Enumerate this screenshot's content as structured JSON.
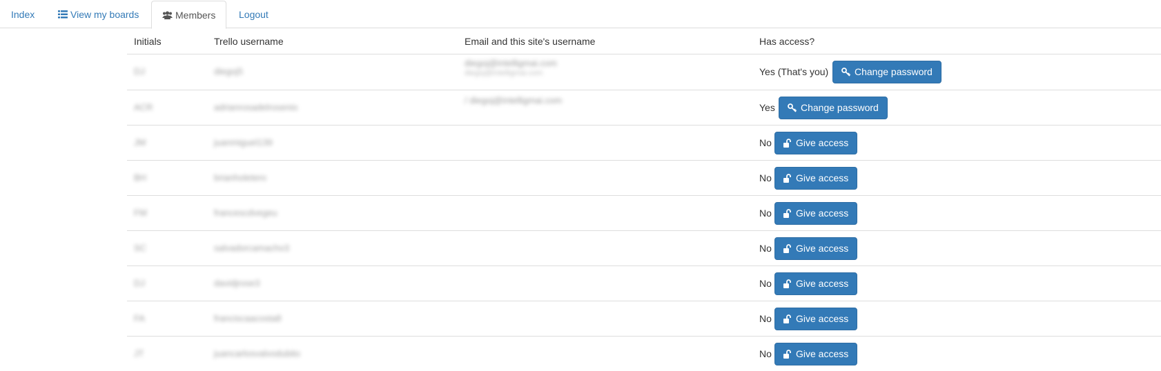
{
  "tabs": [
    {
      "label": "Index",
      "icon": null,
      "active": false
    },
    {
      "label": "View my boards",
      "icon": "boards-list-icon",
      "active": false
    },
    {
      "label": "Members",
      "icon": "users-icon",
      "active": true
    },
    {
      "label": "Logout",
      "icon": null,
      "active": false
    }
  ],
  "table": {
    "headers": {
      "initials": "Initials",
      "username": "Trello username",
      "email": "Email and this site's username",
      "access": "Has access?"
    },
    "rows": [
      {
        "initials": "DJ",
        "username": "diegoj5",
        "email": "diegoj@intelligmai.com",
        "email_sub": "diegoj@intelligmai.com",
        "access": "Yes (That's you)",
        "button": "Change password",
        "button_icon": "key-icon"
      },
      {
        "initials": "ACR",
        "username": "adrianrosadelrosenio",
        "email": "/ diegoj@intelligmai.com",
        "email_sub": "",
        "access": "Yes",
        "button": "Change password",
        "button_icon": "key-icon"
      },
      {
        "initials": "JM",
        "username": "juanmiguel139",
        "email": "",
        "email_sub": "",
        "access": "No",
        "button": "Give access",
        "button_icon": "unlock-icon"
      },
      {
        "initials": "BH",
        "username": "brianholetero",
        "email": "",
        "email_sub": "",
        "access": "No",
        "button": "Give access",
        "button_icon": "unlock-icon"
      },
      {
        "initials": "FM",
        "username": "francescdvegeu",
        "email": "",
        "email_sub": "",
        "access": "No",
        "button": "Give access",
        "button_icon": "unlock-icon"
      },
      {
        "initials": "SC",
        "username": "salvadorcamacho3",
        "email": "",
        "email_sub": "",
        "access": "No",
        "button": "Give access",
        "button_icon": "unlock-icon"
      },
      {
        "initials": "DJ",
        "username": "davidjrose3",
        "email": "",
        "email_sub": "",
        "access": "No",
        "button": "Give access",
        "button_icon": "unlock-icon"
      },
      {
        "initials": "FA",
        "username": "franciscaacosta8",
        "email": "",
        "email_sub": "",
        "access": "No",
        "button": "Give access",
        "button_icon": "unlock-icon"
      },
      {
        "initials": "JT",
        "username": "juancarlosvalvodubito",
        "email": "",
        "email_sub": "",
        "access": "No",
        "button": "Give access",
        "button_icon": "unlock-icon"
      }
    ]
  },
  "colors": {
    "link": "#337ab7",
    "button_bg": "#337ab7",
    "button_border": "#2e6da4",
    "border": "#dddddd"
  }
}
